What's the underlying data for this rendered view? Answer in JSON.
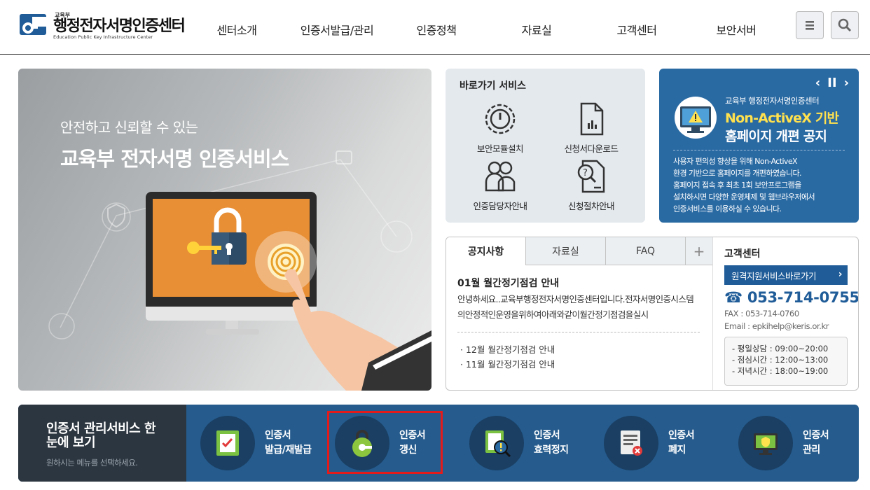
{
  "header": {
    "logo_small": "교육부",
    "logo_title": "행정전자서명인증센터",
    "logo_en": "Education Public Key Infrastructure Center",
    "nav": [
      "센터소개",
      "인증서발급/관리",
      "인증정책",
      "자료실",
      "고객센터",
      "보안서버"
    ],
    "menu_icon": "hamburger-icon",
    "search_icon": "search-icon"
  },
  "hero": {
    "subtitle": "안전하고 신뢰할 수 있는",
    "title": "교육부 전자서명 인증서비스"
  },
  "quick": {
    "title": "바로가기 서비스",
    "items": [
      "보안모듈설치",
      "신청서다운로드",
      "인증담당자안내",
      "신청절차안내"
    ]
  },
  "banner": {
    "org": "교육부 행정전자서명인증센터",
    "title1": "Non-ActiveX 기반",
    "title2": "홈페이지 개편 공지",
    "body1": "사용자 편의성 향상을 위해 Non-ActiveX",
    "body2": "환경 기반으로 홈페이지를 개편하였습니다.",
    "body3": "홈페이지 접속 후 최초 1회 보안프로그램을",
    "body4": "설치하시면 다양한 운영체제 및 웹브라우저에서",
    "body5": "인증서비스를 이용하실 수 있습니다.",
    "prev": "‹",
    "pause": "II",
    "next": "›"
  },
  "board": {
    "tabs": [
      "공지사항",
      "자료실",
      "FAQ"
    ],
    "more": "+",
    "notice_title": "01월 월간정기점검 안내",
    "notice_body": "안녕하세요..교육부행정전자서명인증센터입니다.전자서명인증시스템의안정적인운영을위하여아래와같이월간정기점검을실시",
    "list": [
      "· 12월 월간정기점검 안내",
      "· 11월 월간정기점검 안내"
    ]
  },
  "customer": {
    "title": "고객센터",
    "remote_btn": "원격지원서비스바로가기",
    "phone": "☎ 053-714-0755",
    "fax": "FAX : 053-714-0760",
    "email": "Email : epkihelp@keris.or.kr",
    "hours": [
      "-  평일상담 : 09:00~20:00",
      "-  점심시간 : 12:00~13:00",
      "-  저녁시간 : 18:00~19:00"
    ]
  },
  "bottom": {
    "title": "인증서 관리서비스 한눈에 보기",
    "subtitle": "원하시는 메뉴를 선택하세요.",
    "services": [
      {
        "line1": "인증서",
        "line2": "발급/재발급"
      },
      {
        "line1": "인증서",
        "line2": "갱신"
      },
      {
        "line1": "인증서",
        "line2": "효력정지"
      },
      {
        "line1": "인증서",
        "line2": "폐지"
      },
      {
        "line1": "인증서",
        "line2": "관리"
      }
    ]
  },
  "colors": {
    "brand_blue": "#1f5c98",
    "banner_blue": "#2a6aa3",
    "bottom_blue": "#255b8d",
    "highlight_red": "#e31b1b",
    "banner_yellow": "#ffe14d"
  }
}
